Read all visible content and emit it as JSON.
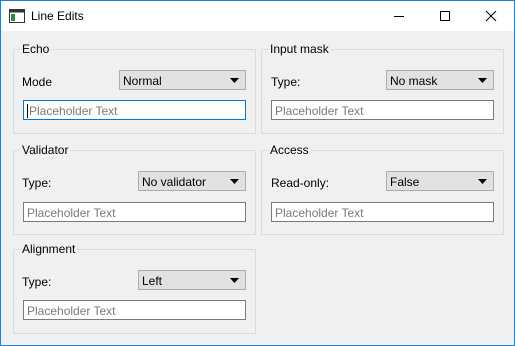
{
  "window": {
    "title": "Line Edits"
  },
  "titlebar_icons": {
    "app": "window-app-icon",
    "minimize": "minimize-icon",
    "maximize": "maximize-icon",
    "close": "close-icon"
  },
  "echo": {
    "title": "Echo",
    "mode_label": "Mode",
    "mode_value": "Normal",
    "placeholder": "Placeholder Text"
  },
  "input_mask": {
    "title": "Input mask",
    "type_label": "Type:",
    "type_value": "No mask",
    "placeholder": "Placeholder Text"
  },
  "validator": {
    "title": "Validator",
    "type_label": "Type:",
    "type_value": "No validator",
    "placeholder": "Placeholder Text"
  },
  "access": {
    "title": "Access",
    "readonly_label": "Read-only:",
    "readonly_value": "False",
    "placeholder": "Placeholder Text"
  },
  "alignment": {
    "title": "Alignment",
    "type_label": "Type:",
    "type_value": "Left",
    "placeholder": "Placeholder Text"
  }
}
